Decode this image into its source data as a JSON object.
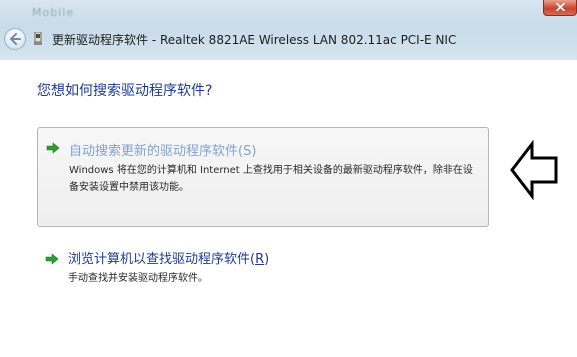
{
  "window": {
    "title": "更新驱动程序软件 - Realtek 8821AE Wireless LAN 802.11ac PCI-E NIC",
    "blurred_caption": "Mobile"
  },
  "dialog": {
    "question": "您想如何搜索驱动程序软件?",
    "options": [
      {
        "title": "自动搜索更新的驱动程序软件(S)",
        "description": "Windows 将在您的计算机和 Internet 上查找用于相关设备的最新驱动程序软件，除非在设备安装设置中禁用该功能。",
        "icon": "green-arrow-icon"
      },
      {
        "title_main": "浏览计算机以查找驱动程序软件(",
        "title_key": "R",
        "title_end": ")",
        "description": "手动查找并安装驱动程序软件。",
        "icon": "green-arrow-icon"
      }
    ]
  },
  "colors": {
    "link": "#1e3d8f",
    "link_hover": "#7ea3cf",
    "arrow_green": "#2f9e2f"
  }
}
